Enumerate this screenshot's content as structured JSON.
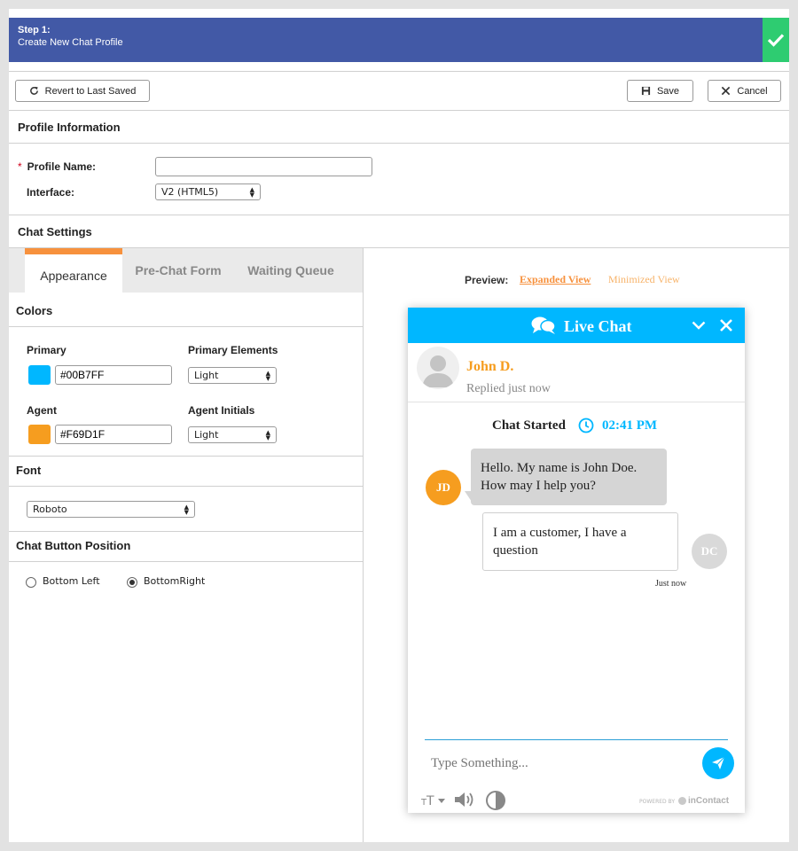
{
  "step": {
    "title": "Step 1:",
    "subtitle": "Create New Chat Profile"
  },
  "toolbar": {
    "revert_label": "Revert to Last Saved",
    "save_label": "Save",
    "cancel_label": "Cancel"
  },
  "profile": {
    "section_title": "Profile Information",
    "required_mark": "*",
    "name_label": "Profile Name:",
    "name_value": "",
    "interface_label": "Interface:",
    "interface_value": "V2 (HTML5)"
  },
  "chat_settings": {
    "section_title": "Chat Settings",
    "tabs": [
      {
        "label": "Appearance"
      },
      {
        "label": "Pre-Chat Form"
      },
      {
        "label": "Waiting Queue"
      }
    ],
    "colors": {
      "title": "Colors",
      "primary_label": "Primary",
      "primary_value": "#00B7FF",
      "primary_elements_label": "Primary Elements",
      "primary_elements_value": "Light",
      "agent_label": "Agent",
      "agent_value": "#F69D1F",
      "agent_initials_label": "Agent Initials",
      "agent_initials_value": "Light"
    },
    "font": {
      "title": "Font",
      "value": "Roboto"
    },
    "position": {
      "title": "Chat Button Position",
      "options": [
        {
          "label": "Bottom Left"
        },
        {
          "label": "BottomRight"
        }
      ],
      "selected": "BottomRight"
    }
  },
  "preview": {
    "label": "Preview:",
    "expanded_link": "Expanded View",
    "minimized_link": "Minimized View",
    "widget": {
      "title": "Live Chat",
      "agent_name": "John D.",
      "agent_status": "Replied just now",
      "chat_started_label": "Chat Started",
      "chat_started_time": "02:41 PM",
      "agent_initials": "JD",
      "agent_message": "Hello. My name is John Doe. How may I help you?",
      "customer_initials": "DC",
      "customer_message": "I am a customer, I have a question",
      "customer_time": "Just now",
      "input_placeholder": "Type Something...",
      "powered_by": "POWERED BY",
      "brand": "inContact"
    }
  },
  "colors": {
    "header": "#4259a6",
    "check": "#2ecc71",
    "accent_orange": "#f7913d",
    "primary": "#00B7FF",
    "agent": "#F69D1F"
  }
}
